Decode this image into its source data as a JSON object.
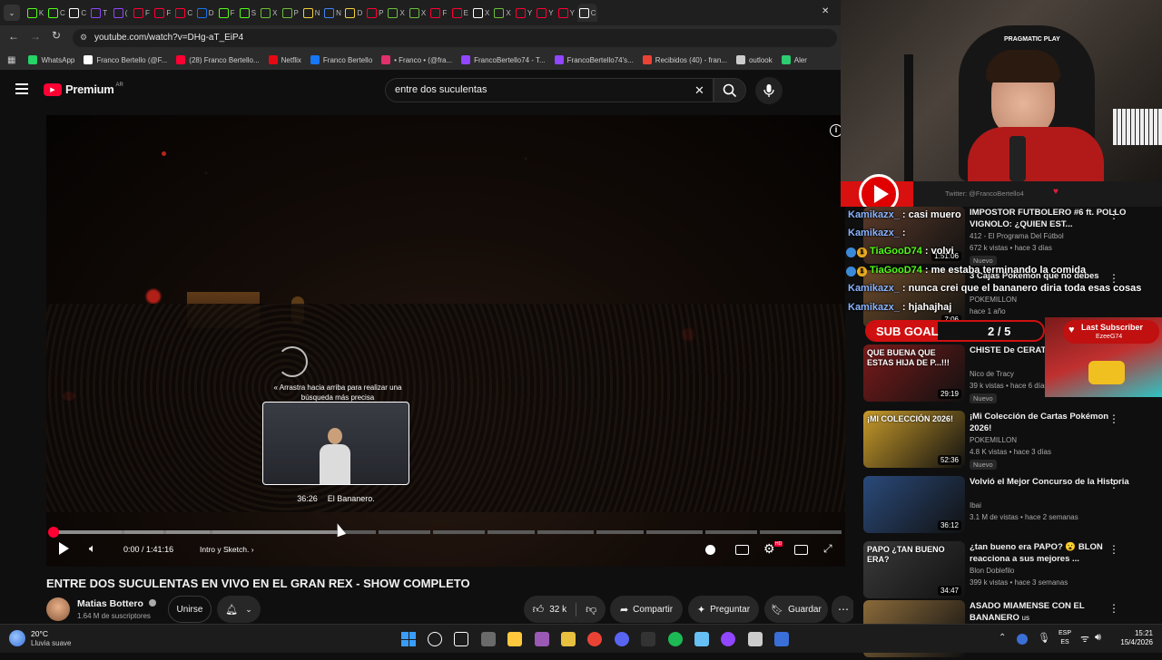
{
  "browser": {
    "tabs": [
      {
        "letter": "K",
        "color": "#53fc18"
      },
      {
        "letter": "C",
        "color": "#53fc18"
      },
      {
        "letter": "C",
        "color": "#ffffff"
      },
      {
        "letter": "T",
        "color": "#9146ff"
      },
      {
        "letter": "(",
        "color": "#9146ff"
      },
      {
        "letter": "F",
        "color": "#ff0033"
      },
      {
        "letter": "F",
        "color": "#ff0033"
      },
      {
        "letter": "C",
        "color": "#ff0033"
      },
      {
        "letter": "D",
        "color": "#1a73e8"
      },
      {
        "letter": "F",
        "color": "#53fc18"
      },
      {
        "letter": "S",
        "color": "#53fc18"
      },
      {
        "letter": "X",
        "color": "#6cbf3b"
      },
      {
        "letter": "P",
        "color": "#6cbf3b"
      },
      {
        "letter": "N",
        "color": "#f4d03f"
      },
      {
        "letter": "N",
        "color": "#4285f4"
      },
      {
        "letter": "D",
        "color": "#f4d03f"
      },
      {
        "letter": "P",
        "color": "#ff0033"
      },
      {
        "letter": "X",
        "color": "#6cbf3b"
      },
      {
        "letter": "X",
        "color": "#6cbf3b"
      },
      {
        "letter": "F",
        "color": "#ff0033"
      },
      {
        "letter": "E",
        "color": "#ff0033"
      },
      {
        "letter": "X",
        "color": "#ffffff"
      },
      {
        "letter": "X",
        "color": "#6cbf3b"
      },
      {
        "letter": "Y",
        "color": "#ff0033"
      },
      {
        "letter": "Y",
        "color": "#ff0033"
      },
      {
        "letter": "Y",
        "color": "#ff0033"
      },
      {
        "letter": "C",
        "color": "#ffffff"
      }
    ],
    "url": "youtube.com/watch?v=DHg-aT_EiP4",
    "bookmarks": [
      {
        "label": "WhatsApp",
        "color": "#25d366"
      },
      {
        "label": "Franco Bertello (@F...",
        "color": "#ffffff"
      },
      {
        "label": "(28) Franco Bertello...",
        "color": "#ff0033"
      },
      {
        "label": "Netflix",
        "color": "#e50914"
      },
      {
        "label": "Franco Bertello",
        "color": "#1877f2"
      },
      {
        "label": "• Franco • (@fra...",
        "color": "#e1306c"
      },
      {
        "label": "FrancoBertello74 - T...",
        "color": "#9146ff"
      },
      {
        "label": "FrancoBertello74's...",
        "color": "#9146ff"
      },
      {
        "label": "Recibidos (40) - fran...",
        "color": "#ea4335"
      },
      {
        "label": "outlook",
        "color": "#cccccc"
      },
      {
        "label": "Aler",
        "color": "#2ecc71"
      }
    ]
  },
  "youtube": {
    "logo": "Premium",
    "region": "AR",
    "search_value": "entre dos suculentas",
    "player": {
      "hint": "Arrastra hacia arriba para realizar una búsqueda más precisa",
      "preview_time": "36:26",
      "preview_chapter": "El Bananero.",
      "time_current": "0:00",
      "time_total": "1:41:16",
      "chapter": "Intro y Sketch.",
      "hover_fraction": 0.36,
      "hd_badge": "HD"
    },
    "video_title": "ENTRE DOS SUCULENTAS EN VIVO EN EL GRAN REX - SHOW COMPLETO",
    "channel": {
      "name": "Matias Bottero",
      "subscribers": "1.64 M de suscriptores",
      "join_label": "Unirse"
    },
    "actions": {
      "likes": "32 k",
      "share": "Compartir",
      "ask": "Preguntar",
      "save": "Guardar"
    }
  },
  "overlay": {
    "twitter": "Twitter: @FrancoBertello4",
    "sub_goal_label": "SUB GOAL",
    "sub_goal_value": "2 / 5",
    "last_sub_label": "Last Subscriber",
    "last_sub_name": "EzeeG74",
    "chat": [
      {
        "user": "Kamikazx_",
        "msg": ": casi muero",
        "color": "#8ab4ff"
      },
      {
        "user": "Kamikazx_",
        "msg": ":",
        "color": "#8ab4ff"
      },
      {
        "user": "TiaGooD74",
        "msg": ": volvi",
        "color": "#53fc18"
      },
      {
        "user": "TiaGooD74",
        "msg": ": me estaba terminando la comida",
        "color": "#53fc18"
      },
      {
        "user": "Kamikazx_",
        "msg": ": nunca crei que el bananero diria toda esas cosas",
        "color": "#8ab4ff"
      },
      {
        "user": "Kamikazx_",
        "msg": ": hjahajhaj",
        "color": "#8ab4ff"
      }
    ],
    "chat_badge": "1"
  },
  "recommendations": [
    {
      "title": "IMPOSTOR FUTBOLERO #6 ft. POLLO VIGNOLO: ¿QUIEN EST...",
      "channel": "412 - El Programa Del Fútbol",
      "meta": "672 k vistas • hace 3 días",
      "badge": "Nuevo",
      "duration": "1:51:06",
      "thumb": "#5a3a2a"
    },
    {
      "title": "3 Cajas Pokemon que no debes",
      "channel": "POKEMILLON",
      "meta": "hace 1 año",
      "badge": "",
      "duration": "7:06",
      "thumb": "#6b4a2a"
    },
    {
      "title": "CHISTE De CERATI ARRANCAMOS Con",
      "channel": "Nico de Tracy",
      "meta": "39 k vistas • hace 6 días",
      "badge": "Nuevo",
      "duration": "29:19",
      "thumb": "#7a1a1a",
      "thumb_text": "QUE BUENA QUE ESTAS HIJA DE P...!!!"
    },
    {
      "title": "¡Mi Colección de Cartas Pokémon 2026!",
      "channel": "POKEMILLON",
      "meta": "4.8 K vistas • hace 3 días",
      "badge": "Nuevo",
      "duration": "52:36",
      "thumb": "#c79a2a",
      "thumb_text": "¡MI COLECCIÓN 2026!"
    },
    {
      "title": "Volvió el Mejor Concurso de la Historia",
      "channel": "Ibai",
      "meta": "3.1 M de vistas • hace 2 semanas",
      "badge": "",
      "duration": "36:12",
      "thumb": "#2a4a7a"
    },
    {
      "title": "¿tan bueno era PAPO? 😮 BLON reacciona a sus mejores ...",
      "channel": "Blon Doblefilo",
      "meta": "399 k vistas • hace 3 semanas",
      "badge": "",
      "duration": "34:47",
      "thumb": "#3a3a3a",
      "thumb_text": "PAPO ¿TAN BUENO ERA?"
    },
    {
      "title": "ASADO MIAMENSE CON EL BANANERO ",
      "channel": "",
      "meta": "",
      "badge": "",
      "duration": "",
      "thumb": "#8a6a3a",
      "title_suffix": "us"
    }
  ],
  "taskbar": {
    "temp": "20°C",
    "weather": "Lluvia suave",
    "lang1": "ESP",
    "lang2": "ES",
    "time": "15:21",
    "date": "15/4/2026",
    "apps": [
      "#ffffff",
      "#ffffff",
      "#6a6a6a",
      "#ffc83d",
      "#9b59b6",
      "#e8c040",
      "#ea4335",
      "#5865f2",
      "#333333",
      "#1db954",
      "#66c0f4",
      "#9146ff",
      "#cccccc",
      "#3a6fd8"
    ]
  },
  "colors": {
    "yt_red": "#ff0033",
    "progress_gray": "#5a5a5a",
    "progress_light": "#9a9a9a"
  }
}
